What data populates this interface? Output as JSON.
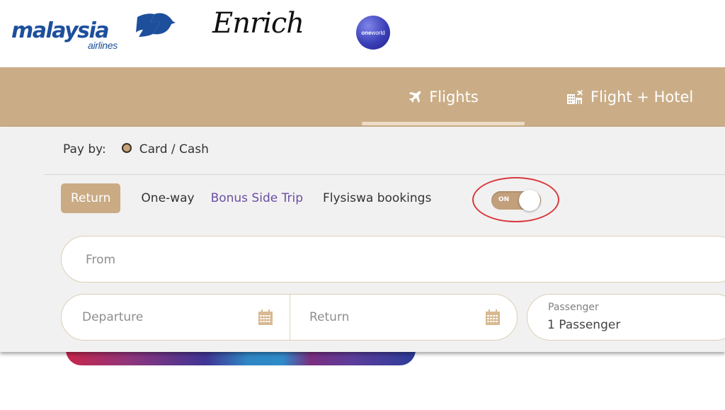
{
  "header": {
    "logos": {
      "airline": {
        "word": "malaysia",
        "sub": "airlines"
      },
      "loyalty": "Enrich",
      "alliance": {
        "bold": "one",
        "rest": "world"
      }
    }
  },
  "tabs": [
    {
      "label": "Flights",
      "icon": "plane-icon",
      "active": true
    },
    {
      "label": "Flight + Hotel",
      "icon": "hotel-plane-icon",
      "active": false
    }
  ],
  "booking": {
    "pay_by": {
      "label": "Pay by:",
      "option": "Card / Cash",
      "selected": true
    },
    "trip_types": {
      "return": "Return",
      "oneway": "One-way",
      "bonus": "Bonus Side Trip",
      "flysiswa": "Flysiswa bookings"
    },
    "flysiswa_toggle": {
      "state_label": "ON",
      "on": true
    },
    "from": {
      "placeholder": "From"
    },
    "departure": {
      "placeholder": "Departure"
    },
    "return_date": {
      "placeholder": "Return"
    },
    "passenger": {
      "label": "Passenger",
      "value": "1 Passenger"
    }
  },
  "colors": {
    "brand_gold": "#caad87",
    "accent_purple": "#6a4fa3",
    "annotation_red": "#d8393d",
    "airline_blue": "#1d4f9c"
  }
}
